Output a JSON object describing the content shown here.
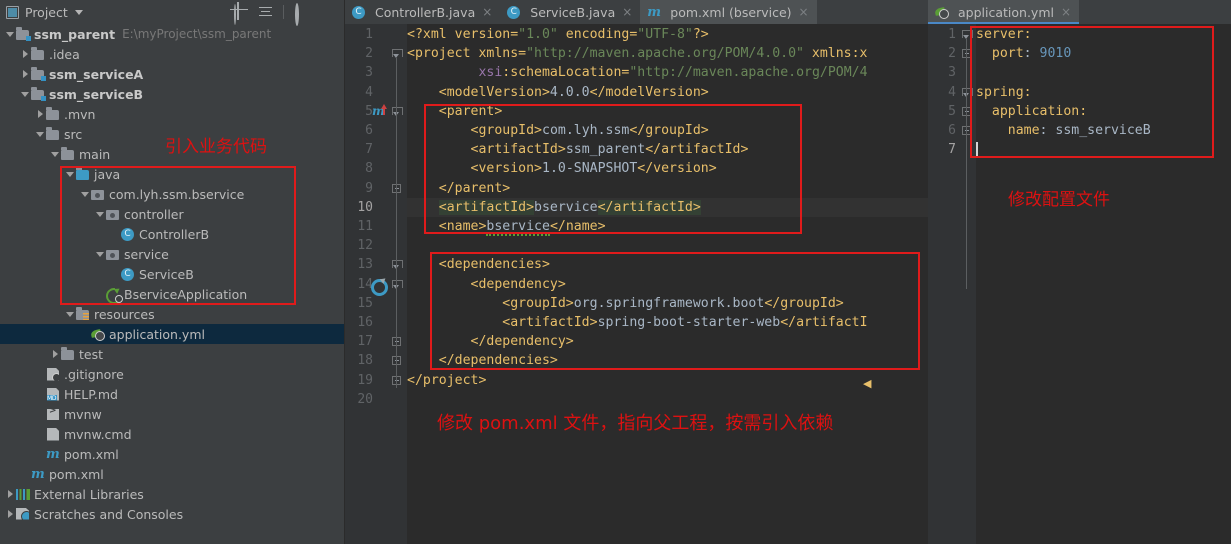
{
  "project_panel": {
    "title": "Project",
    "icons": [
      "project-icon",
      "chevron-down-icon",
      "locate-icon",
      "collapse-all-icon",
      "gear-icon",
      "minimize-icon"
    ],
    "tree": [
      {
        "indent": 0,
        "arrow": "down",
        "icon": "module-folder-icon",
        "label": "ssm_parent",
        "bold": true,
        "path": "E:\\myProject\\ssm_parent"
      },
      {
        "indent": 1,
        "arrow": "right",
        "icon": "folder-icon",
        "label": ".idea",
        "bold": false,
        "path": ""
      },
      {
        "indent": 1,
        "arrow": "right",
        "icon": "module-folder-icon",
        "label": "ssm_serviceA",
        "bold": true,
        "path": ""
      },
      {
        "indent": 1,
        "arrow": "down",
        "icon": "module-folder-icon",
        "label": "ssm_serviceB",
        "bold": true,
        "path": ""
      },
      {
        "indent": 2,
        "arrow": "right",
        "icon": "folder-icon",
        "label": ".mvn",
        "bold": false,
        "path": ""
      },
      {
        "indent": 2,
        "arrow": "down",
        "icon": "folder-icon",
        "label": "src",
        "bold": false,
        "path": ""
      },
      {
        "indent": 3,
        "arrow": "down",
        "icon": "folder-icon",
        "label": "main",
        "bold": false,
        "path": ""
      },
      {
        "indent": 4,
        "arrow": "down",
        "icon": "source-folder-icon",
        "label": "java",
        "bold": false,
        "path": ""
      },
      {
        "indent": 5,
        "arrow": "down",
        "icon": "package-icon",
        "label": "com.lyh.ssm.bservice",
        "bold": false,
        "path": ""
      },
      {
        "indent": 6,
        "arrow": "down",
        "icon": "package-icon",
        "label": "controller",
        "bold": false,
        "path": ""
      },
      {
        "indent": 7,
        "arrow": "none",
        "icon": "java-class-icon",
        "label": "ControllerB",
        "bold": false,
        "path": ""
      },
      {
        "indent": 6,
        "arrow": "down",
        "icon": "package-icon",
        "label": "service",
        "bold": false,
        "path": ""
      },
      {
        "indent": 7,
        "arrow": "none",
        "icon": "java-class-icon",
        "label": "ServiceB",
        "bold": false,
        "path": ""
      },
      {
        "indent": 6,
        "arrow": "none",
        "icon": "spring-boot-app-icon",
        "label": "BserviceApplication",
        "bold": false,
        "path": ""
      },
      {
        "indent": 4,
        "arrow": "down",
        "icon": "resources-folder-icon",
        "label": "resources",
        "bold": false,
        "path": ""
      },
      {
        "indent": 5,
        "arrow": "none",
        "icon": "spring-yaml-icon",
        "label": "application.yml",
        "bold": false,
        "path": "",
        "selected": true
      },
      {
        "indent": 3,
        "arrow": "right",
        "icon": "folder-icon",
        "label": "test",
        "bold": false,
        "path": ""
      },
      {
        "indent": 2,
        "arrow": "none",
        "icon": "gitignore-icon",
        "label": ".gitignore",
        "bold": false,
        "path": ""
      },
      {
        "indent": 2,
        "arrow": "none",
        "icon": "markdown-icon",
        "label": "HELP.md",
        "bold": false,
        "path": ""
      },
      {
        "indent": 2,
        "arrow": "none",
        "icon": "shell-script-icon",
        "label": "mvnw",
        "bold": false,
        "path": ""
      },
      {
        "indent": 2,
        "arrow": "none",
        "icon": "cmd-file-icon",
        "label": "mvnw.cmd",
        "bold": false,
        "path": ""
      },
      {
        "indent": 2,
        "arrow": "none",
        "icon": "maven-pom-icon",
        "label": "pom.xml",
        "bold": false,
        "path": ""
      },
      {
        "indent": 1,
        "arrow": "none",
        "icon": "maven-pom-icon",
        "label": "pom.xml",
        "bold": false,
        "path": ""
      },
      {
        "indent": 0,
        "arrow": "right",
        "icon": "external-libraries-icon",
        "label": "External Libraries",
        "bold": false,
        "path": ""
      },
      {
        "indent": 0,
        "arrow": "right",
        "icon": "scratches-icon",
        "label": "Scratches and Consoles",
        "bold": false,
        "path": ""
      }
    ]
  },
  "tabs_left": [
    {
      "label": "ControllerB.java",
      "icon": "java-class-icon",
      "active": false,
      "close": "×"
    },
    {
      "label": "ServiceB.java",
      "icon": "java-class-icon",
      "active": false,
      "close": "×"
    },
    {
      "label": "pom.xml (bservice)",
      "icon": "maven-pom-icon",
      "active": true,
      "close": "×"
    }
  ],
  "tabs_right": [
    {
      "label": "application.yml",
      "icon": "spring-yaml-icon",
      "active": true,
      "close": "×"
    }
  ],
  "editor_left": {
    "line_numbers": [
      "1",
      "2",
      "3",
      "4",
      "5",
      "6",
      "7",
      "8",
      "9",
      "10",
      "11",
      "12",
      "13",
      "14",
      "15",
      "16",
      "17",
      "18",
      "19",
      "20"
    ],
    "lines": [
      "<?xml version=\"1.0\" encoding=\"UTF-8\"?>",
      "<project xmlns=\"http://maven.apache.org/POM/4.0.0\" xmlns:x",
      "         xsi:schemaLocation=\"http://maven.apache.org/POM/4",
      "    <modelVersion>4.0.0</modelVersion>",
      "    <parent>",
      "        <groupId>com.lyh.ssm</groupId>",
      "        <artifactId>ssm_parent</artifactId>",
      "        <version>1.0-SNAPSHOT</version>",
      "    </parent>",
      "    <artifactId>bservice</artifactId>",
      "    <name>bservice</name>",
      "",
      "    <dependencies>",
      "        <dependency>",
      "            <groupId>org.springframework.boot</groupId>",
      "            <artifactId>spring-boot-starter-web</artifactI",
      "        </dependency>",
      "    </dependencies>",
      "</project>",
      ""
    ]
  },
  "editor_right": {
    "line_numbers": [
      "1",
      "2",
      "3",
      "4",
      "5",
      "6",
      "7"
    ],
    "lines": [
      "server:",
      "  port: 9010",
      "",
      "spring:",
      "  application:",
      "    name: ssm_serviceB",
      ""
    ],
    "port_value": "9010",
    "app_name_value": "ssm_serviceB"
  },
  "annotations": [
    {
      "id": "note-business-code",
      "text": "引入业务代码"
    },
    {
      "id": "note-config-file",
      "text": "修改配置文件"
    },
    {
      "id": "note-pom-file",
      "text": "修改 pom.xml 文件，指向父工程，按需引入依赖"
    }
  ],
  "colors": {
    "annotation_red": "#dd1111",
    "editor_bg": "#2b2b2b",
    "panel_bg": "#3c3f41",
    "selection_blue": "#0d293e",
    "tag_color": "#e8bf6a",
    "string_color": "#6a8759"
  }
}
